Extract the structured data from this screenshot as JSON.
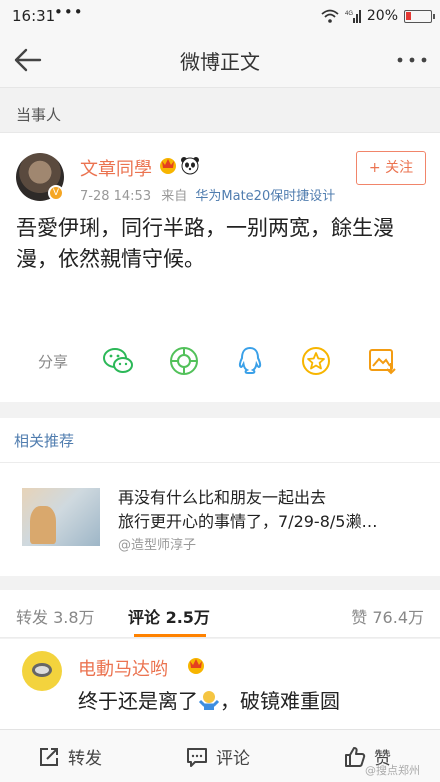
{
  "status_bar": {
    "time": "16:31",
    "dots": "•••",
    "battery_pct": "20%",
    "battery_level": 0.2
  },
  "nav": {
    "title": "微博正文"
  },
  "section": {
    "label": "当事人"
  },
  "post": {
    "author": "文章同學",
    "time": "7-28 14:53",
    "source_prefix": "来自",
    "source": "华为Mate20保时捷设计",
    "follow_label": "关注",
    "text": "吾愛伊琍，同行半路，一别两宽，餘生漫漫，依然親情守候。",
    "share_label": "分享"
  },
  "related": {
    "title": "相关推荐",
    "line1": "再没有什么比和朋友一起出去",
    "line2": "旅行更开心的事情了，7/29-8/5濑…",
    "author": "@造型师淳子"
  },
  "tabs": {
    "repost": "转发 3.8万",
    "comment": "评论 2.5万",
    "like": "赞 76.4万"
  },
  "comment": {
    "author": "电動马达哟",
    "text_before": "终于还是离了",
    "text_after": "，破镜难重圆"
  },
  "toolbar": {
    "repost": "转发",
    "comment": "评论",
    "like": "赞"
  },
  "watermark": "@搜点郑州",
  "colors": {
    "accent": "#eb7350",
    "link": "#507daf",
    "tab_underline": "#ff8200"
  }
}
